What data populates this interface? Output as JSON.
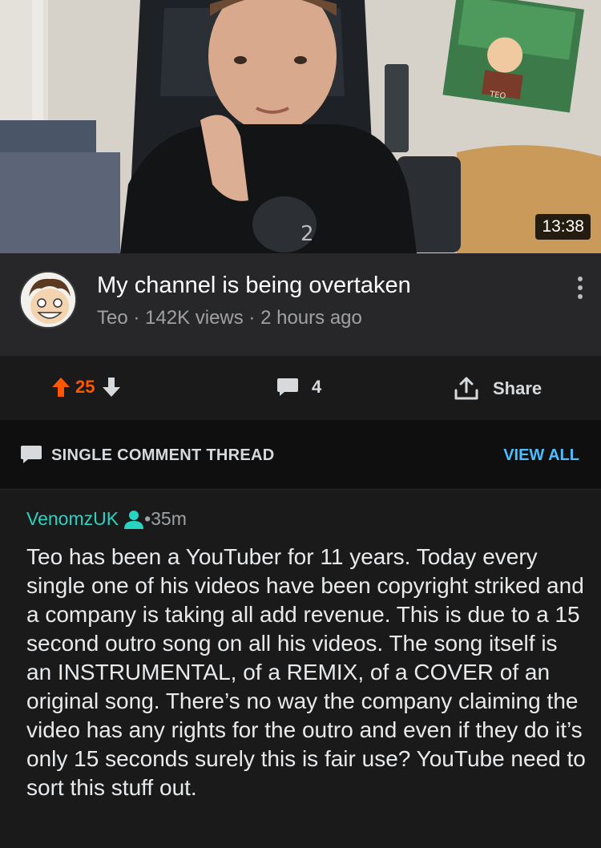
{
  "video": {
    "duration": "13:38",
    "poster_text": "TEO"
  },
  "post": {
    "title": "My channel is being overtaken",
    "author": "Teo",
    "views": "142K views",
    "age": "2 hours ago",
    "separator": " · "
  },
  "actions": {
    "score": "25",
    "comments": "4",
    "share_label": "Share"
  },
  "thread": {
    "label": "SINGLE COMMENT THREAD",
    "view_all": "VIEW ALL"
  },
  "comment": {
    "username": "VenomzUK",
    "separator": " • ",
    "time": "35m",
    "body": "Teo has been a YouTuber for 11 years. Today every single one of his videos have been copyright striked and a company is taking all add revenue. This is due to a 15 second outro song on all his videos. The song itself is an INSTRUMENTAL, of a REMIX, of a COVER of an original song. There’s no way the company claiming the video has any rights for the outro and even if they do it’s only 15 seconds surely this is fair use? YouTube need to sort this stuff out."
  },
  "colors": {
    "upvote": "#ff5700",
    "username": "#29d3c2",
    "link": "#4fbcff",
    "background": "#1a1a1b"
  },
  "icons": [
    "more-vertical-icon",
    "upvote-arrow-icon",
    "downvote-arrow-icon",
    "comment-bubble-icon",
    "share-icon",
    "thread-bubble-icon",
    "user-person-icon"
  ]
}
